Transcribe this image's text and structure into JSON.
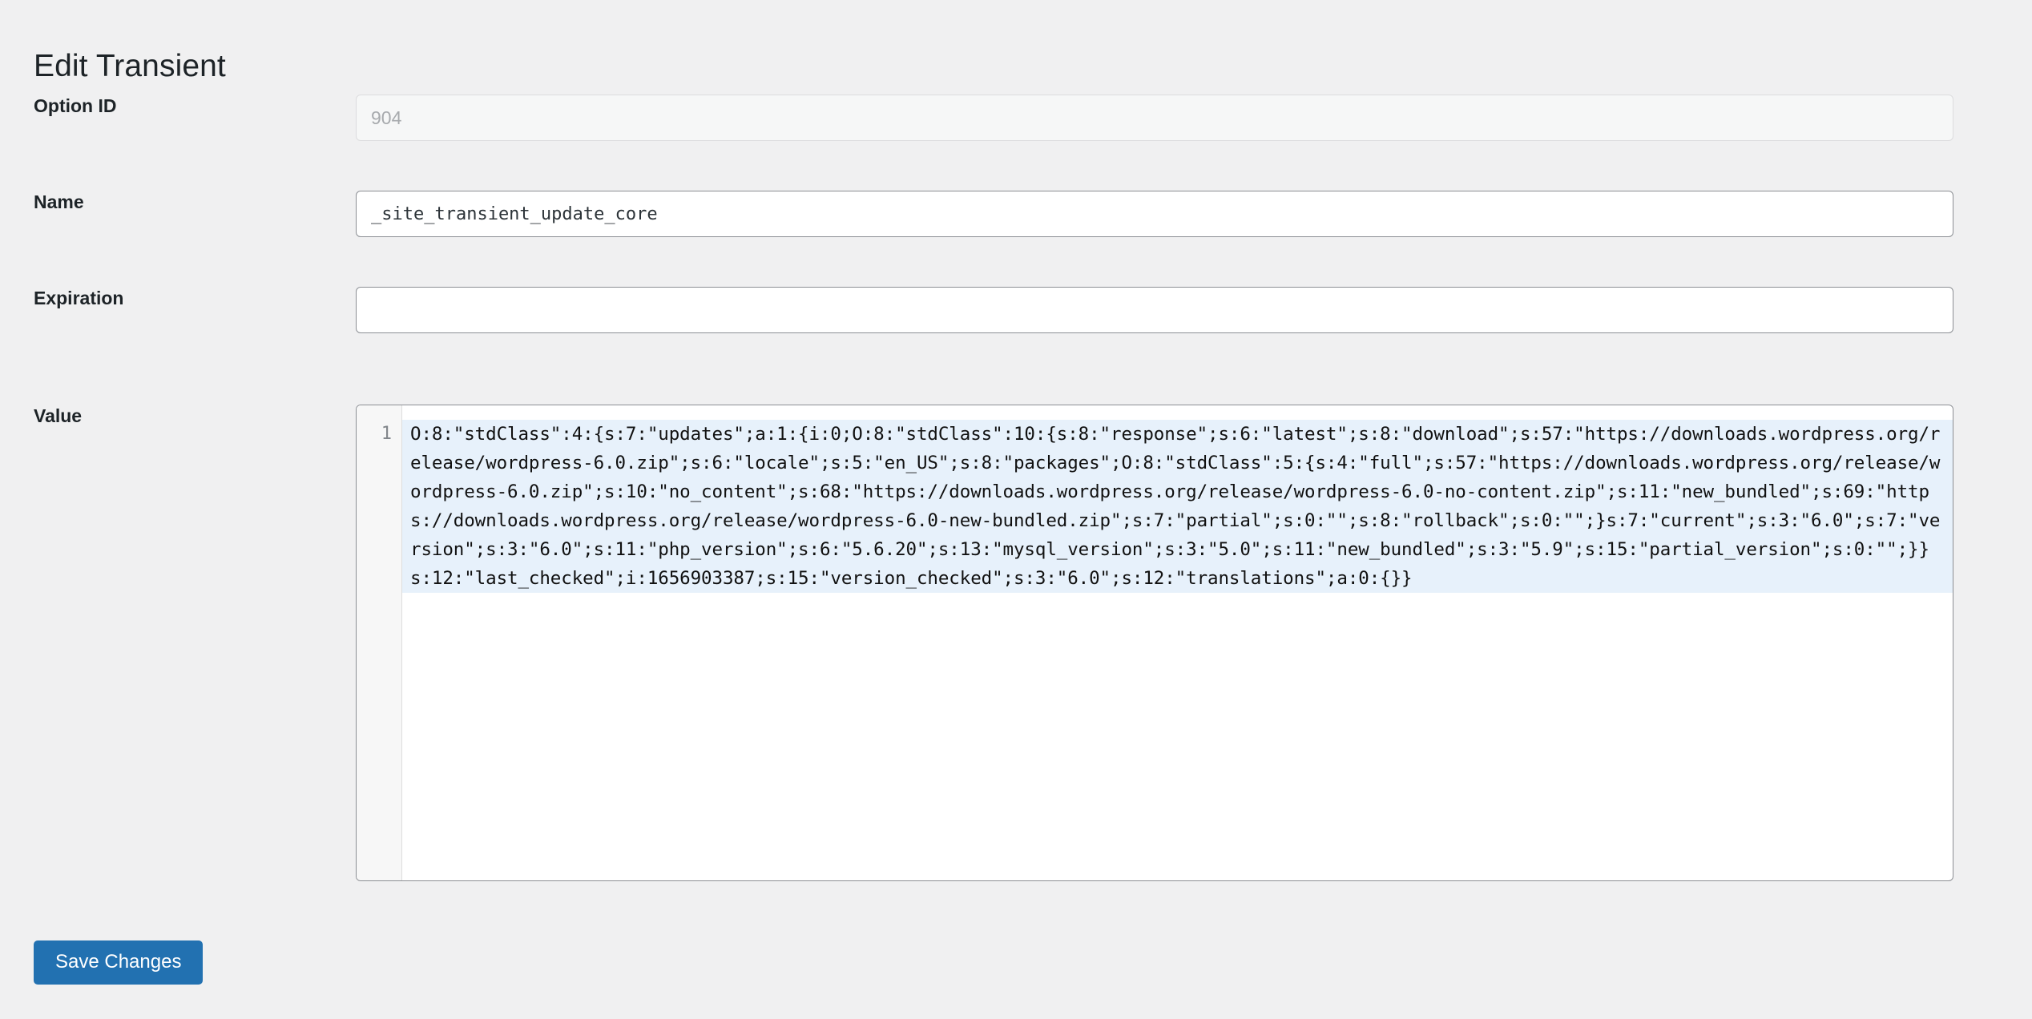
{
  "page": {
    "title": "Edit Transient"
  },
  "fields": {
    "option_id": {
      "label": "Option ID",
      "value": "904",
      "placeholder": "",
      "disabled": true
    },
    "name": {
      "label": "Name",
      "value": "_site_transient_update_core",
      "placeholder": ""
    },
    "expiration": {
      "label": "Expiration",
      "value": "",
      "placeholder": ""
    },
    "value": {
      "label": "Value",
      "line_number": "1",
      "content": "O:8:\"stdClass\":4:{s:7:\"updates\";a:1:{i:0;O:8:\"stdClass\":10:{s:8:\"response\";s:6:\"latest\";s:8:\"download\";s:57:\"https://downloads.wordpress.org/release/wordpress-6.0.zip\";s:6:\"locale\";s:5:\"en_US\";s:8:\"packages\";O:8:\"stdClass\":5:{s:4:\"full\";s:57:\"https://downloads.wordpress.org/release/wordpress-6.0.zip\";s:10:\"no_content\";s:68:\"https://downloads.wordpress.org/release/wordpress-6.0-no-content.zip\";s:11:\"new_bundled\";s:69:\"https://downloads.wordpress.org/release/wordpress-6.0-new-bundled.zip\";s:7:\"partial\";s:0:\"\";s:8:\"rollback\";s:0:\"\";}s:7:\"current\";s:3:\"6.0\";s:7:\"version\";s:3:\"6.0\";s:11:\"php_version\";s:6:\"5.6.20\";s:13:\"mysql_version\";s:3:\"5.0\";s:11:\"new_bundled\";s:3:\"5.9\";s:15:\"partial_version\";s:0:\"\";}}s:12:\"last_checked\";i:1656903387;s:15:\"version_checked\";s:3:\"6.0\";s:12:\"translations\";a:0:{}}"
    }
  },
  "actions": {
    "save_label": "Save Changes"
  },
  "colors": {
    "accent": "#2271b1",
    "page_background": "#f0f0f1",
    "input_border": "#8c8f94",
    "code_highlight": "#e7f1fb"
  }
}
